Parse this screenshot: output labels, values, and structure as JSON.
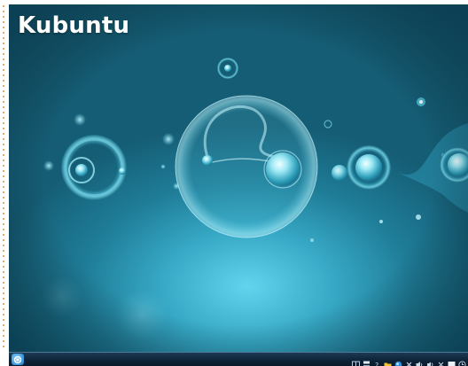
{
  "title": "Kubuntu",
  "taskbar": {
    "launcher_icon": "kde-menu-icon",
    "tray_icons": [
      "pager-icon",
      "tasks-icon",
      "help-icon",
      "folder-icon",
      "network-icon",
      "bluetooth-icon",
      "volume-icon",
      "audio-icon",
      "close-icon",
      "display-icon",
      "clock-icon"
    ]
  },
  "colors": {
    "wallpaper_light": "#62d4ee",
    "wallpaper_dark": "#155d75",
    "panel": "#0d2236",
    "title": "#ffffff"
  }
}
